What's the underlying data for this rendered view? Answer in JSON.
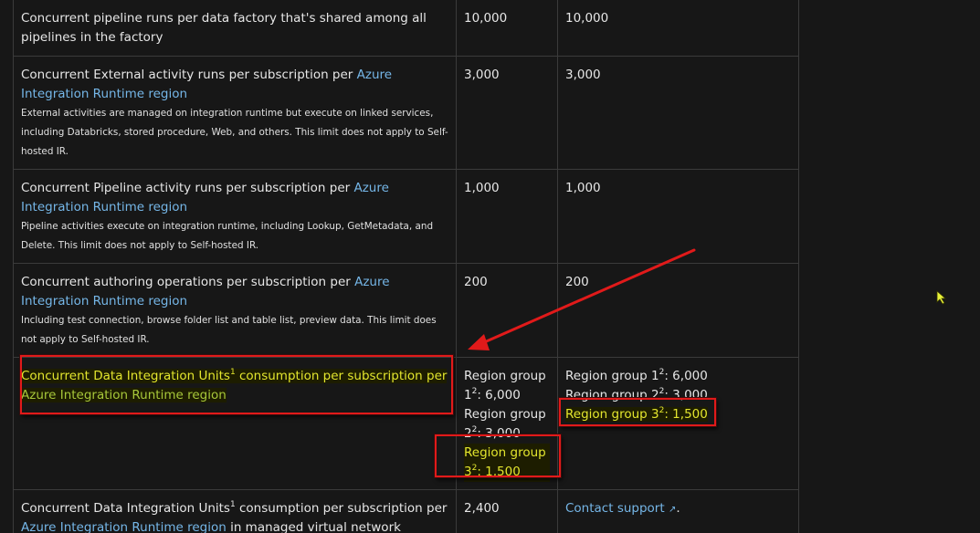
{
  "rows": [
    {
      "resource": "Concurrent pipeline runs per data factory that's shared among all pipelines in the factory",
      "default": "10,000",
      "maximum": "10,000"
    },
    {
      "resource_prefix": "Concurrent External activity runs per subscription per ",
      "resource_link": "Azure Integration Runtime region",
      "note": "External activities are managed on integration runtime but execute on linked services, including Databricks, stored procedure, Web, and others. This limit does not apply to Self-hosted IR.",
      "default": "3,000",
      "maximum": "3,000"
    },
    {
      "resource_prefix": "Concurrent Pipeline activity runs per subscription per ",
      "resource_link": "Azure Integration Runtime region",
      "note": "Pipeline activities execute on integration runtime, including Lookup, GetMetadata, and Delete. This limit does not apply to Self-hosted IR.",
      "default": "1,000",
      "maximum": "1,000"
    },
    {
      "resource_prefix": "Concurrent authoring operations per subscription per ",
      "resource_link": "Azure Integration Runtime region",
      "note": "Including test connection, browse folder list and table list, preview data. This limit does not apply to Self-hosted IR.",
      "default": "200",
      "maximum": "200"
    },
    {
      "resource_prefix": "Concurrent Data Integration Units",
      "resource_sup": "1",
      "resource_mid": " consumption per subscription per ",
      "resource_link": "Azure Integration Runtime region",
      "default_g1": "Region group 1",
      "default_g1_sup": "2",
      "default_g1_val": ": 6,000",
      "default_g2": "Region group 2",
      "default_g2_sup": "2",
      "default_g2_val": ": 3,000",
      "default_g3": "Region group 3",
      "default_g3_sup": "2",
      "default_g3_val": ": 1,500",
      "max_g1": "Region group 1",
      "max_g1_sup": "2",
      "max_g1_val": ": 6,000",
      "max_g2": "Region group 2",
      "max_g2_sup": "2",
      "max_g2_val": ": 3,000",
      "max_g3": "Region group 3",
      "max_g3_sup": "2",
      "max_g3_val": ": 1,500"
    },
    {
      "resource_prefix": "Concurrent Data Integration Units",
      "resource_sup": "1",
      "resource_mid": " consumption per subscription per ",
      "resource_link": "Azure Integration Runtime region",
      "resource_suffix": " in managed virtual network",
      "default": "2,400",
      "maximum_link": "Contact support",
      "maximum_suffix": "."
    }
  ],
  "colors": {
    "background": "#171717",
    "link": "#75b6e7",
    "highlight_text": "#e3e62e",
    "annotation_red": "#e11a1a"
  },
  "icons": [
    "external-link-icon",
    "mouse-cursor-icon",
    "annotation-arrow"
  ]
}
